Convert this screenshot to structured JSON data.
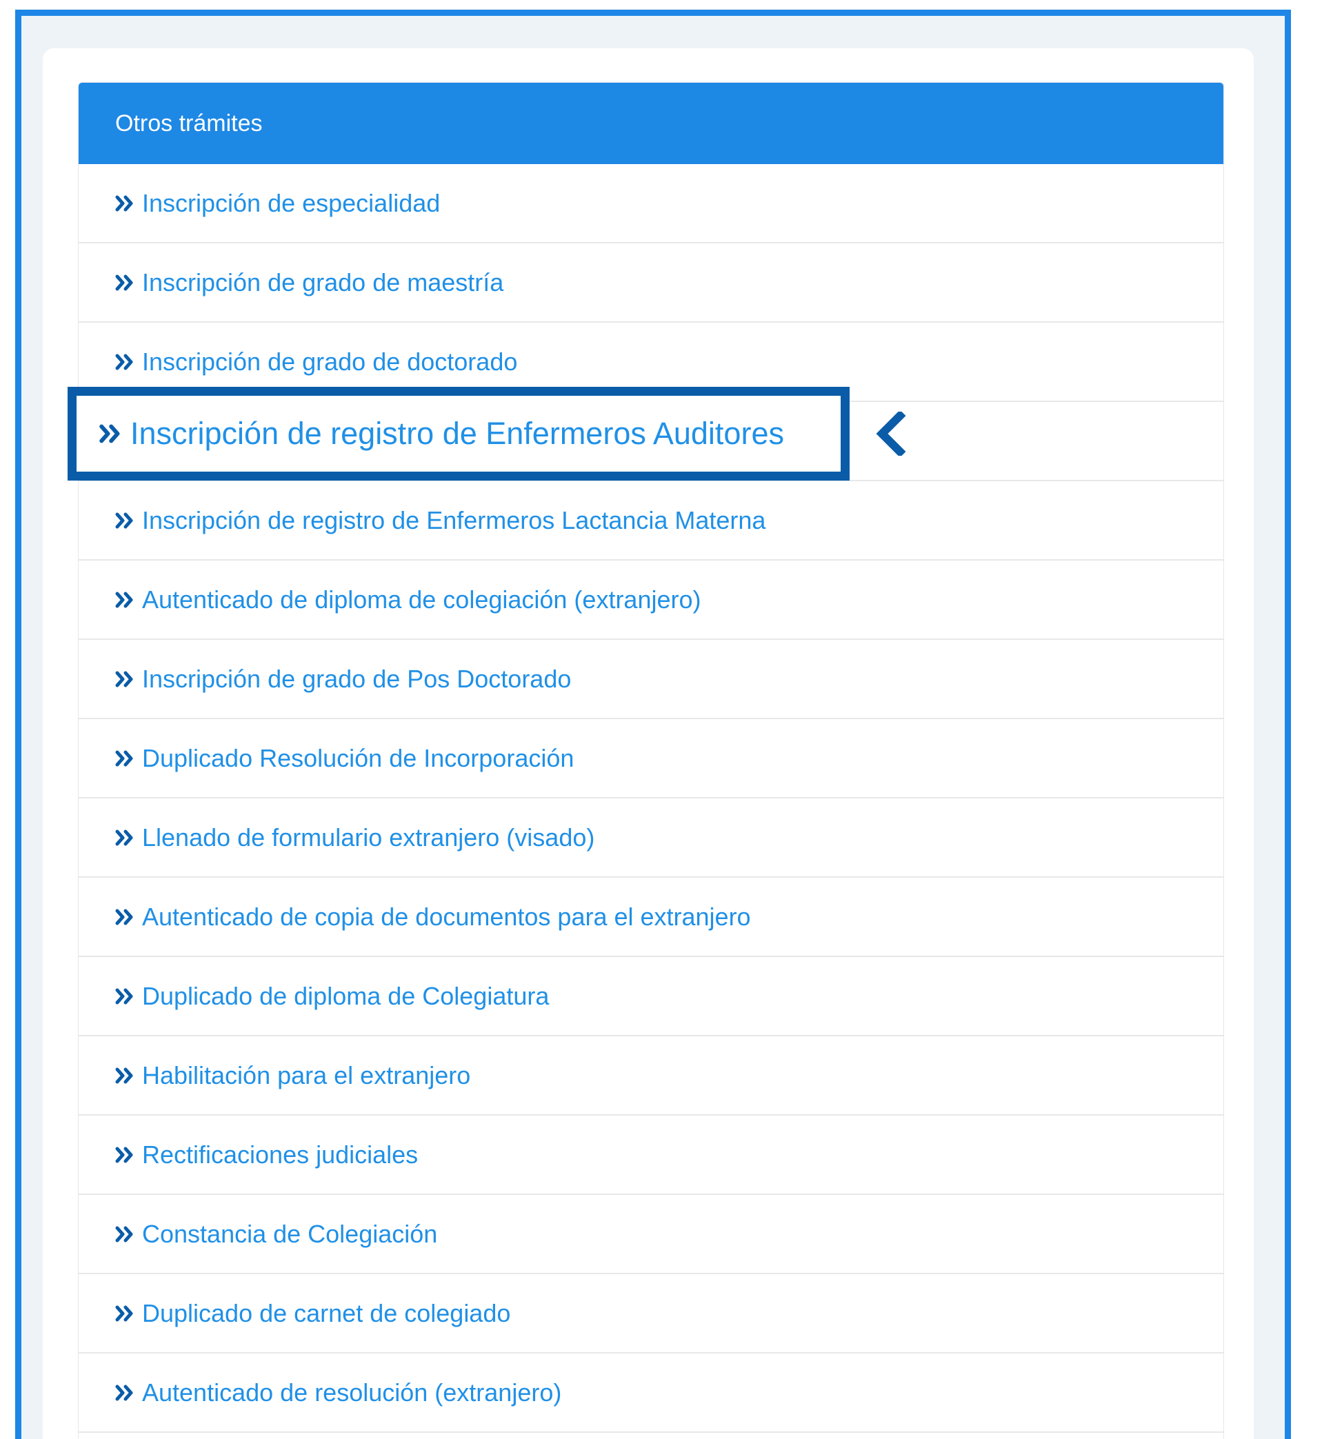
{
  "panel": {
    "title": "Otros trámites"
  },
  "items": [
    {
      "label": "Inscripción de especialidad"
    },
    {
      "label": "Inscripción de grado de maestría"
    },
    {
      "label": "Inscripción de grado de doctorado"
    },
    {
      "label": "Inscripción de registro de Enfermeros Auditores"
    },
    {
      "label": "Inscripción de registro de Enfermeros Lactancia Materna"
    },
    {
      "label": "Autenticado de diploma de colegiación (extranjero)"
    },
    {
      "label": "Inscripción de grado de Pos Doctorado"
    },
    {
      "label": "Duplicado Resolución de Incorporación"
    },
    {
      "label": "Llenado de formulario extranjero (visado)"
    },
    {
      "label": "Autenticado de copia de documentos para el extranjero"
    },
    {
      "label": "Duplicado de diploma de Colegiatura"
    },
    {
      "label": "Habilitación para el extranjero"
    },
    {
      "label": "Rectificaciones judiciales"
    },
    {
      "label": "Constancia de Colegiación"
    },
    {
      "label": "Duplicado de carnet de colegiado"
    },
    {
      "label": "Autenticado de resolución (extranjero)"
    }
  ],
  "highlight": {
    "item_index": 3,
    "arrow_icon": "chevron-left-icon"
  },
  "colors": {
    "frame": "#1e86e6",
    "header": "#1e88e5",
    "link": "#2090e6",
    "highlight_border": "#0a5ca8"
  }
}
